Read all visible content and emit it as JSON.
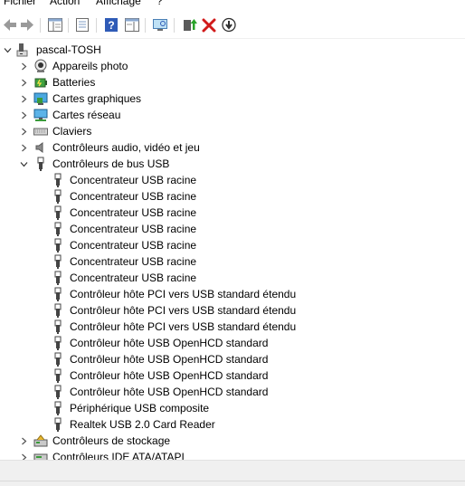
{
  "menu": {
    "items": [
      {
        "label": "Fichier"
      },
      {
        "label": "Action"
      },
      {
        "label": "Affichage"
      },
      {
        "label": "?"
      }
    ]
  },
  "toolbar": {
    "buttons": [
      {
        "icon": "back-arrow-icon"
      },
      {
        "icon": "forward-arrow-icon"
      },
      {
        "icon": "console-tree-icon"
      },
      {
        "icon": "properties-icon"
      },
      {
        "icon": "help-icon"
      },
      {
        "icon": "action-pane-icon"
      },
      {
        "icon": "scan-hardware-icon"
      },
      {
        "icon": "update-driver-icon"
      },
      {
        "icon": "uninstall-device-icon"
      },
      {
        "icon": "disable-device-icon"
      }
    ]
  },
  "tree": {
    "root": {
      "label": "pascal-TOSH",
      "expanded": true
    },
    "categories": [
      {
        "label": "Appareils photo",
        "expanded": false,
        "icon": "camera-icon"
      },
      {
        "label": "Batteries",
        "expanded": false,
        "icon": "battery-icon"
      },
      {
        "label": "Cartes graphiques",
        "expanded": false,
        "icon": "display-adapter-icon"
      },
      {
        "label": "Cartes réseau",
        "expanded": false,
        "icon": "network-adapter-icon"
      },
      {
        "label": "Claviers",
        "expanded": false,
        "icon": "keyboard-icon"
      },
      {
        "label": "Contrôleurs audio, vidéo et jeu",
        "expanded": false,
        "icon": "speaker-icon"
      },
      {
        "label": "Contrôleurs de bus USB",
        "expanded": true,
        "icon": "usb-plug-icon"
      }
    ],
    "usb_devices": [
      {
        "label": "Concentrateur USB racine"
      },
      {
        "label": "Concentrateur USB racine"
      },
      {
        "label": "Concentrateur USB racine"
      },
      {
        "label": "Concentrateur USB racine"
      },
      {
        "label": "Concentrateur USB racine"
      },
      {
        "label": "Concentrateur USB racine"
      },
      {
        "label": "Concentrateur USB racine"
      },
      {
        "label": "Contrôleur hôte PCI vers USB standard étendu"
      },
      {
        "label": "Contrôleur hôte PCI vers USB standard étendu"
      },
      {
        "label": "Contrôleur hôte PCI vers USB standard étendu"
      },
      {
        "label": "Contrôleur hôte USB OpenHCD standard"
      },
      {
        "label": "Contrôleur hôte USB OpenHCD standard"
      },
      {
        "label": "Contrôleur hôte USB OpenHCD standard"
      },
      {
        "label": "Contrôleur hôte USB OpenHCD standard"
      },
      {
        "label": "Périphérique USB composite"
      },
      {
        "label": "Realtek USB 2.0 Card Reader"
      }
    ],
    "after": [
      {
        "label": "Contrôleurs de stockage",
        "expanded": false,
        "icon": "storage-controller-icon"
      },
      {
        "label": "Contrôleurs IDE ATA/ATAPI",
        "expanded": false,
        "icon": "ide-controller-icon"
      }
    ]
  }
}
